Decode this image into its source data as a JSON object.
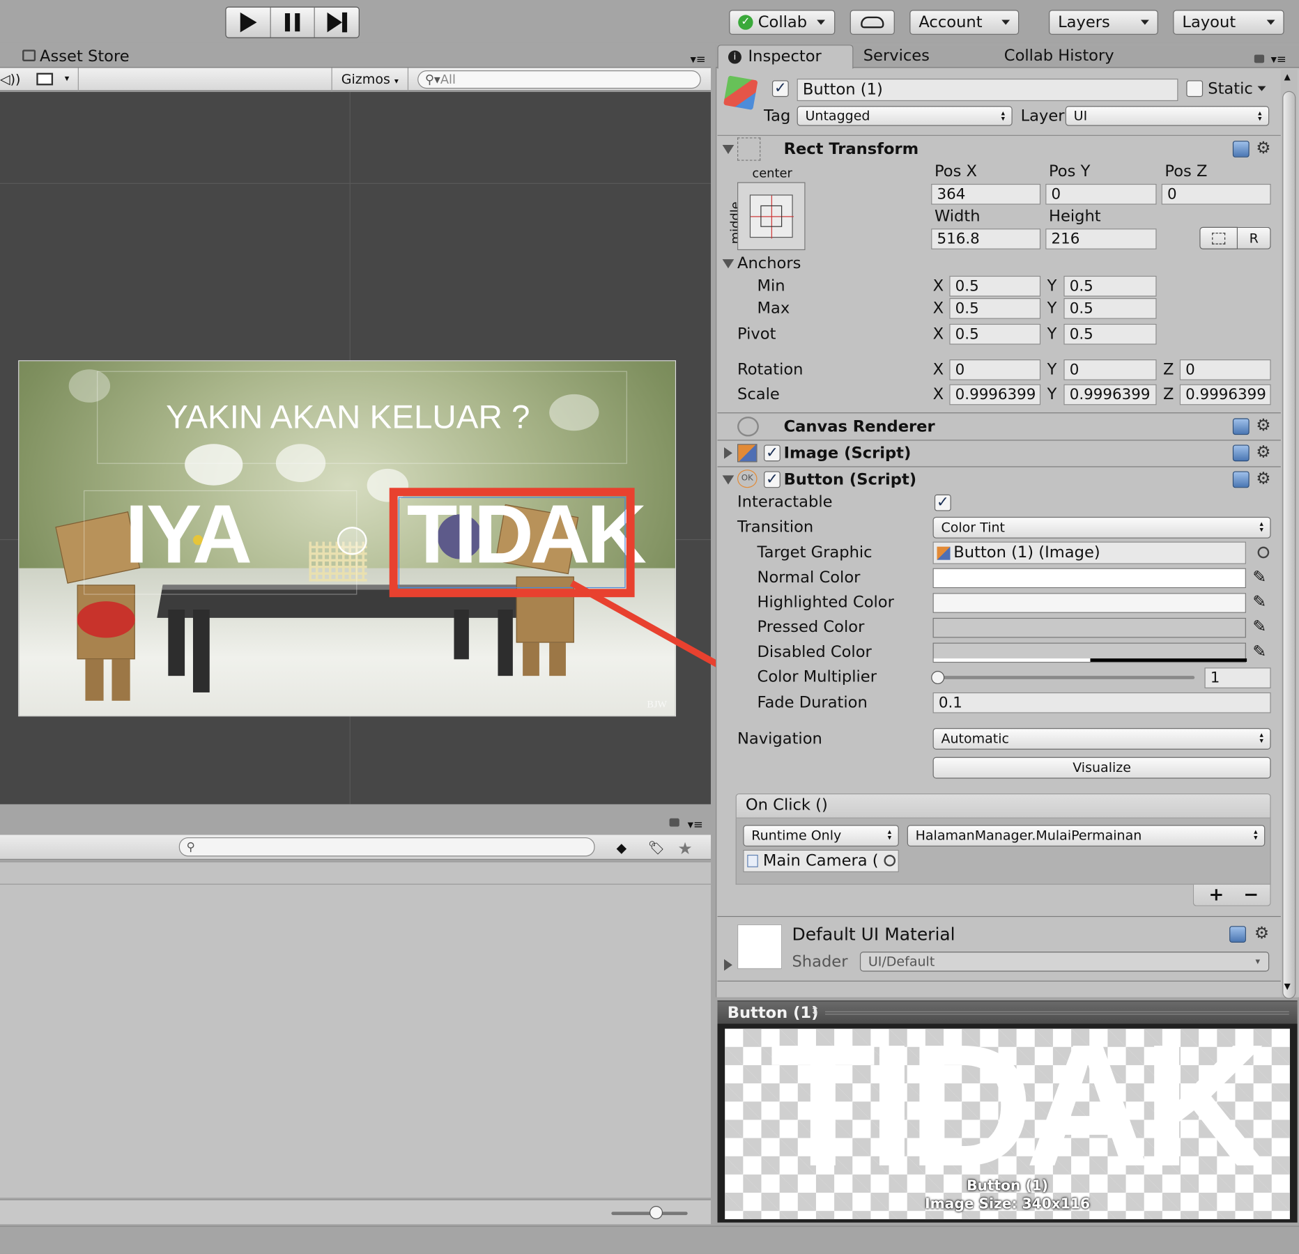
{
  "toolbar": {
    "collab_label": "Collab",
    "account_label": "Account",
    "layers_label": "Layers",
    "layout_label": "Layout"
  },
  "scene": {
    "tab_label": "Asset Store",
    "gizmos_label": "Gizmos",
    "search_placeholder": "All",
    "game_title": "YAKIN AKAN KELUAR ?",
    "btn_yes": "IYA",
    "btn_no": "TIDAK",
    "watermark": "BJW",
    "highlight_color": "#e8412f"
  },
  "inspector": {
    "tabs": [
      "Inspector",
      "Services",
      "Collab History"
    ],
    "object_name": "Button (1)",
    "static_label": "Static",
    "tag_label": "Tag",
    "tag_value": "Untagged",
    "layer_label": "Layer",
    "layer_value": "UI",
    "rect_transform": {
      "title": "Rect Transform",
      "anchor_h": "center",
      "anchor_v": "middle",
      "pos_x_label": "Pos X",
      "pos_x": "364",
      "pos_y_label": "Pos Y",
      "pos_y": "0",
      "pos_z_label": "Pos Z",
      "pos_z": "0",
      "width_label": "Width",
      "width": "516.8",
      "height_label": "Height",
      "height": "216",
      "r_label": "R",
      "anchors_label": "Anchors",
      "min_label": "Min",
      "min_x": "0.5",
      "min_y": "0.5",
      "max_label": "Max",
      "max_x": "0.5",
      "max_y": "0.5",
      "pivot_label": "Pivot",
      "pivot_x": "0.5",
      "pivot_y": "0.5",
      "rotation_label": "Rotation",
      "rot_x": "0",
      "rot_y": "0",
      "rot_z": "0",
      "scale_label": "Scale",
      "scale_x": "0.9996399",
      "scale_y": "0.9996399",
      "scale_z": "0.9996399",
      "x": "X",
      "y": "Y",
      "z": "Z"
    },
    "canvas_renderer": "Canvas Renderer",
    "image_script": "Image (Script)",
    "button_script": {
      "title": "Button (Script)",
      "ok_badge": "OK",
      "interactable_label": "Interactable",
      "transition_label": "Transition",
      "transition_value": "Color Tint",
      "target_graphic_label": "Target Graphic",
      "target_graphic_value": "Button (1) (Image)",
      "normal_color_label": "Normal Color",
      "highlighted_color_label": "Highlighted Color",
      "pressed_color_label": "Pressed Color",
      "disabled_color_label": "Disabled Color",
      "color_multiplier_label": "Color Multiplier",
      "color_multiplier_value": "1",
      "fade_duration_label": "Fade Duration",
      "fade_duration_value": "0.1",
      "navigation_label": "Navigation",
      "navigation_value": "Automatic",
      "visualize_label": "Visualize",
      "onclick_label": "On Click ()",
      "runtime_value": "Runtime Only",
      "function_value": "HalamanManager.MulaiPermainan",
      "object_value": "Main Camera (",
      "plus": "+",
      "minus": "−"
    },
    "material": {
      "name": "Default UI Material",
      "shader_label": "Shader",
      "shader_value": "UI/Default"
    },
    "preview": {
      "title": "Button (1)",
      "big_text": "TIDAK",
      "caption1": "Button (1)",
      "caption2": "Image Size: 340x116"
    }
  }
}
